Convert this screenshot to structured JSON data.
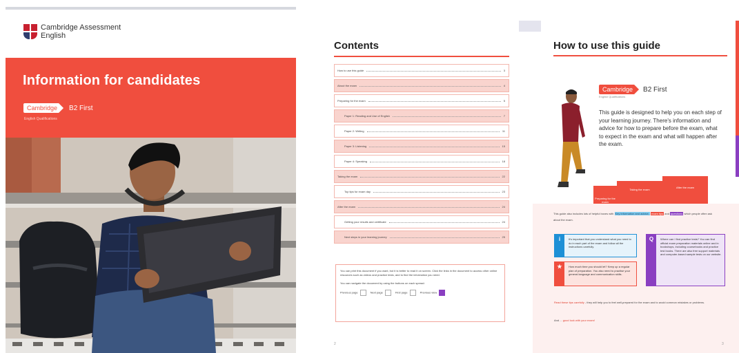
{
  "cover": {
    "org_line1": "Cambridge Assessment",
    "org_line2": "English",
    "title": "Information for candidates",
    "brand_pill": "Cambridge",
    "level": "B2 First",
    "brand_sub": "English Qualifications",
    "colors": {
      "accent": "#f04e3e",
      "logo_blue": "#2f3d6e",
      "logo_red": "#c8202f"
    }
  },
  "contents": {
    "heading": "Contents",
    "items": [
      {
        "label": "How to use this guide",
        "page": "3",
        "kind": "plain"
      },
      {
        "label": "About the exam",
        "page": "4",
        "kind": "sec"
      },
      {
        "label": "Preparing for the exam",
        "page": "5",
        "kind": "plain"
      },
      {
        "label": "Paper 1: Reading and Use of English",
        "page": "7",
        "kind": "sub-sec"
      },
      {
        "label": "Paper 2: Writing",
        "page": "11",
        "kind": "sub"
      },
      {
        "label": "Paper 3: Listening",
        "page": "15",
        "kind": "sub-sec"
      },
      {
        "label": "Paper 4: Speaking",
        "page": "18",
        "kind": "sub"
      },
      {
        "label": "Taking the exam",
        "page": "22",
        "kind": "sec"
      },
      {
        "label": "Top tips for exam day",
        "page": "23",
        "kind": "sub"
      },
      {
        "label": "After the exam",
        "page": "24",
        "kind": "sec"
      },
      {
        "label": "Getting your results and certificate",
        "page": "24",
        "kind": "sub"
      },
      {
        "label": "Next steps in your learning journey",
        "page": "25",
        "kind": "sub-sec"
      }
    ],
    "info_text": "You can print this document if you want, but it is better to read it on screen. Click the links in the document to access other online resources such as videos and practice tests, and to find the information you need.",
    "nav_text": "You can navigate the document by using the buttons on each spread:",
    "nav_buttons": [
      "Previous page",
      "Next page",
      "First page",
      "Previous view"
    ],
    "page_number": "2"
  },
  "howto": {
    "heading": "How to use this guide",
    "brand_pill": "Cambridge",
    "level": "B2 First",
    "brand_sub": "English Qualifications",
    "intro": "This guide is designed to help you on each step of your learning journey. There's information and advice for how to prepare before the exam, what to expect in the exam and what will happen after the exam.",
    "steps": [
      "Preparing for the exam",
      "Taking the exam",
      "After the exam"
    ],
    "panel_text_a": "This guide also includes lots of helpful boxes with",
    "panel_hl_blue": "Key information and advice,",
    "panel_hl_red": "exam tips",
    "panel_text_b": "and",
    "panel_hl_purple": "questions",
    "panel_text_c": "which people often ask about the exam.",
    "tip_info": "It's important that you understand what you need to do in each part of the exam and follow all the instructions carefully.",
    "tip_star": "How much time you should let? Keep up a regular plan of preparation. You also need to practise your general language and communication skills.",
    "tip_question": "Where can I find practice tests? You can find official exam preparation materials online and in bookshops, including coursebooks and practice test books. There are also free support materials and computer-based sample tests on our website.",
    "read_text": "Read these tips carefully",
    "read_rest": "- they will help you to feel well-prepared for the exam and to avoid common mistakes or problems.",
    "good_luck_pre": "And ...",
    "good_luck": "good luck with your exam!",
    "page_number": "3",
    "colors": {
      "info": "#1e90d6",
      "tip": "#f04e3e",
      "question": "#8a3fc1",
      "panel": "#fdf0ef"
    }
  }
}
